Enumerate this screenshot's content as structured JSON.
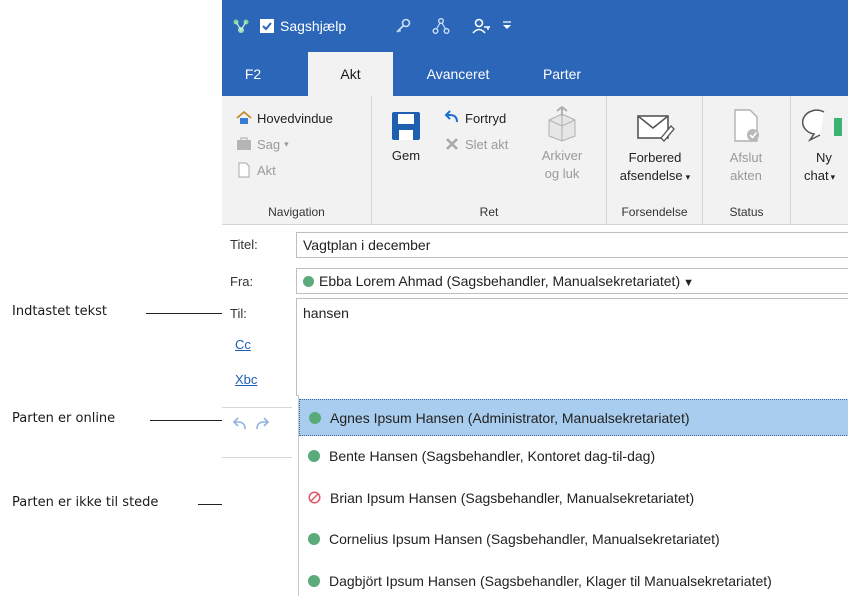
{
  "annotations": {
    "typed_text": "Indtastet tekst",
    "online": "Parten er online",
    "away": "Parten er ikke til stede"
  },
  "titlebar": {
    "title": "Sagshjælp"
  },
  "tabs": [
    "F2",
    "Akt",
    "Avanceret",
    "Parter"
  ],
  "ribbon": {
    "navigation": {
      "main_window": "Hovedvindue",
      "case": "Sag",
      "record": "Akt",
      "label": "Navigation"
    },
    "edit": {
      "save": "Gem",
      "undo": "Fortryd",
      "delete": "Slet akt",
      "archive_line1": "Arkiver",
      "archive_line2": "og luk",
      "label": "Ret"
    },
    "send": {
      "prepare_line1": "Forbered",
      "prepare_line2": "afsendelse",
      "label": "Forsendelse"
    },
    "status": {
      "finish_line1": "Afslut",
      "finish_line2": "akten",
      "label": "Status"
    },
    "chat": {
      "line1": "Ny",
      "line2": "chat"
    }
  },
  "form": {
    "title_label": "Titel:",
    "title_value": "Vagtplan i december",
    "from_label": "Fra:",
    "from_value": "Ebba Lorem Ahmad (Sagsbehandler, Manualsekretariatet)",
    "to_label": "Til:",
    "to_value": "hansen",
    "cc_label": "Cc",
    "bcc_label": "Xbc"
  },
  "suggestions": [
    {
      "name": "Agnes Ipsum Hansen (Administrator, Manualsekretariatet)",
      "status": "online"
    },
    {
      "name": "Bente Hansen (Sagsbehandler, Kontoret dag-til-dag)",
      "status": "online"
    },
    {
      "name": "Brian Ipsum Hansen (Sagsbehandler, Manualsekretariatet)",
      "status": "away"
    },
    {
      "name": "Cornelius Ipsum Hansen (Sagsbehandler, Manualsekretariatet)",
      "status": "online"
    },
    {
      "name": "Dagbjört Ipsum Hansen (Sagsbehandler, Klager til Manualsekretariatet)",
      "status": "online"
    }
  ],
  "colors": {
    "title_bar": "#2b66b8",
    "ribbon": "#f2f2f2",
    "selected_row": "#a9cdee",
    "online": "#5aaa7a",
    "away": "#e0566a",
    "link": "#1c5fb6"
  }
}
